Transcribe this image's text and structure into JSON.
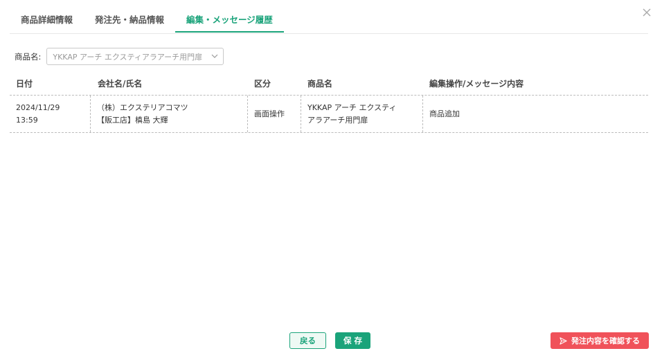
{
  "tabs": [
    {
      "label": "商品詳細情報",
      "active": false
    },
    {
      "label": "発注先・納品情報",
      "active": false
    },
    {
      "label": "編集・メッセージ履歴",
      "active": true
    }
  ],
  "filter": {
    "label": "商品名:",
    "value": "YKKAP アーチ エクスティアラアーチ用門扉"
  },
  "table": {
    "headers": [
      "日付",
      "会社名/氏名",
      "区分",
      "商品名",
      "編集操作/メッセージ内容"
    ],
    "rows": [
      {
        "date": "2024/11/29",
        "time": "13:59",
        "company": "（株）エクステリアコマツ",
        "person": "【販工店】槙島 大輝",
        "category": "画面操作",
        "product_line1": "YKKAP アーチ エクスティ",
        "product_line2": "アラアーチ用門扉",
        "content": "商品追加"
      }
    ]
  },
  "footer": {
    "back_label": "戻る",
    "save_label": "保 存",
    "confirm_label": "発注内容を確認する"
  },
  "colors": {
    "accent": "#1aa37a",
    "danger": "#f0525a"
  },
  "icons": {
    "close": "close-icon",
    "dropdown": "chevron-down-icon",
    "send": "send-icon"
  }
}
